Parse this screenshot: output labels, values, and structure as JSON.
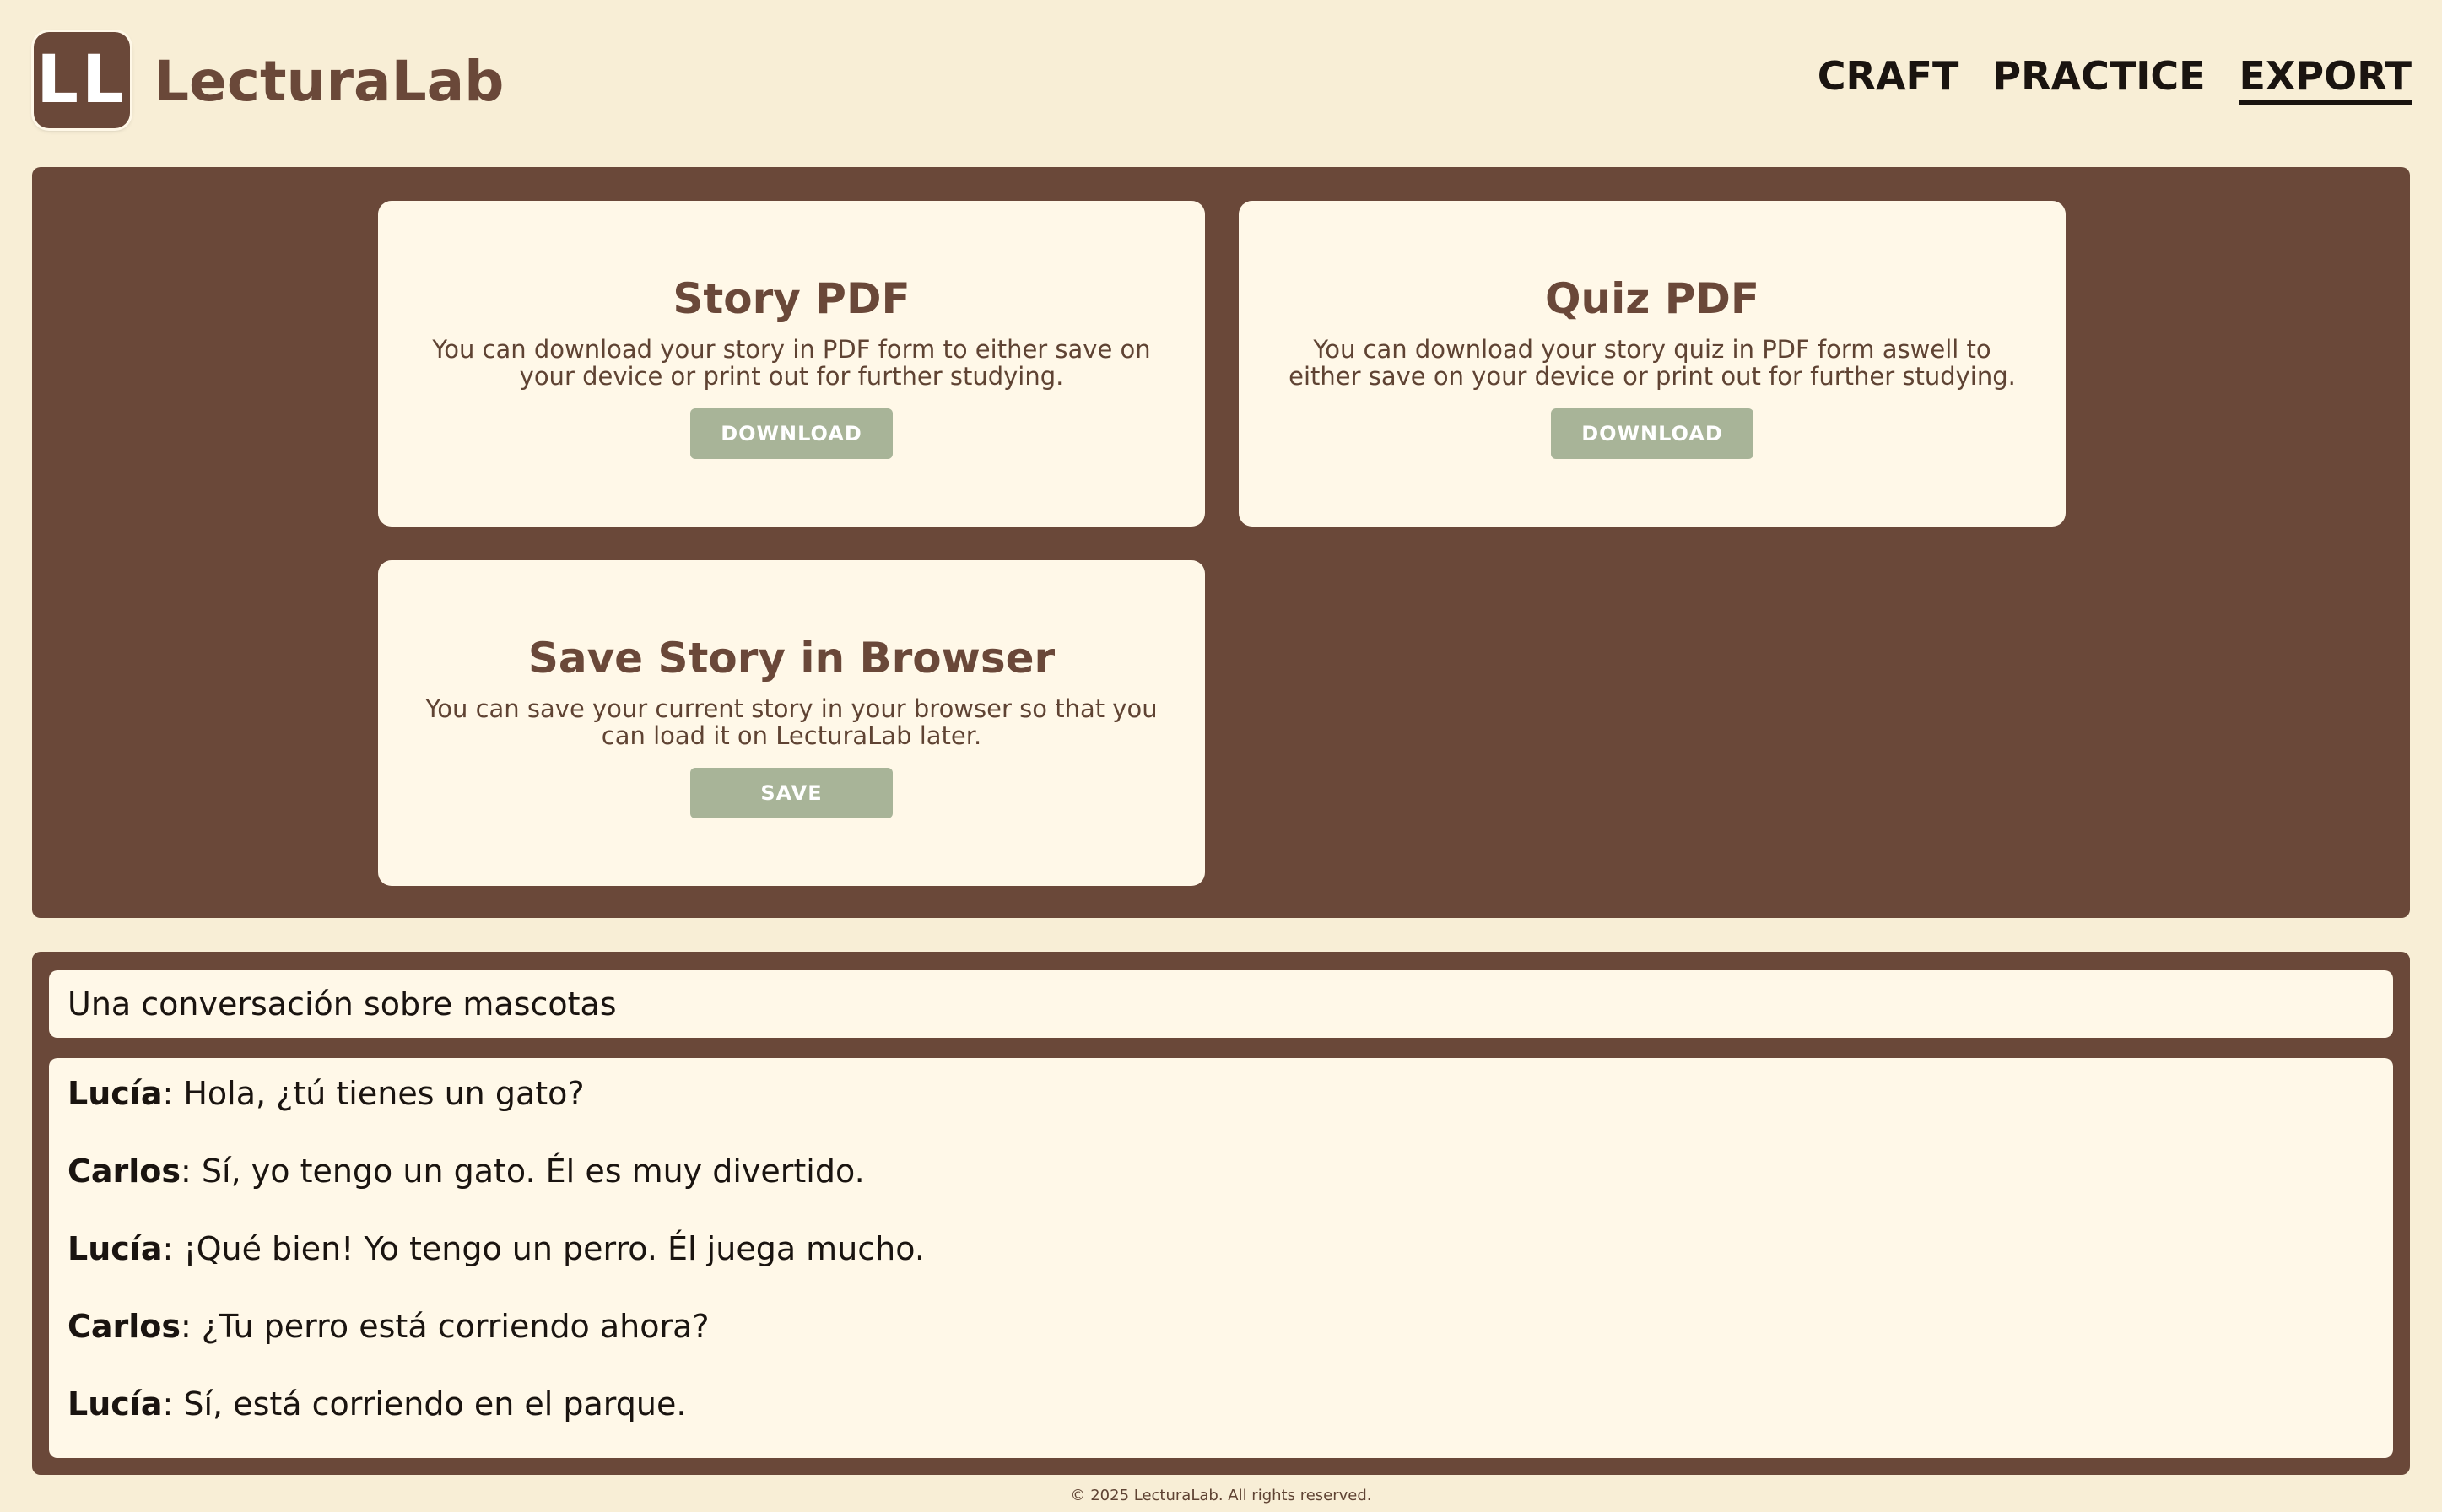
{
  "app": {
    "logo_text": "LL",
    "name": "LecturaLab"
  },
  "nav": {
    "items": [
      {
        "label": "CRAFT",
        "active": false
      },
      {
        "label": "PRACTICE",
        "active": false
      },
      {
        "label": "EXPORT",
        "active": true
      }
    ]
  },
  "export": {
    "cards": [
      {
        "title": "Story PDF",
        "description": "You can download your story in PDF form to either save on your device or print out for further studying.",
        "button_label": "DOWNLOAD"
      },
      {
        "title": "Quiz PDF",
        "description": "You can download your story quiz in PDF form aswell to either save on your device or print out for further studying.",
        "button_label": "DOWNLOAD"
      },
      {
        "title": "Save Story in Browser",
        "description": "You can save your current story in your browser so that you can load it on LecturaLab later.",
        "button_label": "SAVE"
      }
    ]
  },
  "story": {
    "title": "Una conversación sobre mascotas",
    "lines": [
      {
        "speaker": "Lucía",
        "text": ": Hola, ¿tú tienes un gato?"
      },
      {
        "speaker": "Carlos",
        "text": ": Sí, yo tengo un gato. Él es muy divertido."
      },
      {
        "speaker": "Lucía",
        "text": ": ¡Qué bien! Yo tengo un perro. Él juega mucho."
      },
      {
        "speaker": "Carlos",
        "text": ": ¿Tu perro está corriendo ahora?"
      },
      {
        "speaker": "Lucía",
        "text": ": Sí, está corriendo en el parque."
      }
    ]
  },
  "footer": {
    "text": "© 2025 LecturaLab. All rights reserved."
  },
  "colors": {
    "background": "#f8eed6",
    "panel_brown": "#6a4839",
    "card_cream": "#fff8e8",
    "button_sage": "#a8b498",
    "text_dark": "#1a1410"
  }
}
